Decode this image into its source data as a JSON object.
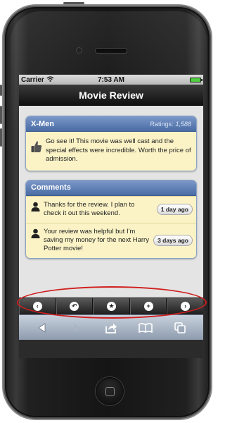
{
  "status_bar": {
    "carrier": "Carrier",
    "time": "7:53 AM",
    "wifi_icon": "wifi-icon",
    "battery_icon": "battery-icon"
  },
  "nav": {
    "title": "Movie Review"
  },
  "review": {
    "title": "X-Men",
    "rating_label": "Ratings:",
    "rating_count": "1,588",
    "icon": "thumbs-up-icon",
    "text": "Go see it! This movie was well cast and the special effects were incredible. Worth the price of admission."
  },
  "comments": {
    "title": "Comments",
    "items": [
      {
        "text": "Thanks for the review. I plan to check it out this weekend.",
        "time": "1 day ago",
        "icon": "person-icon"
      },
      {
        "text": "Your review was helpful but I'm saving my money for the next Harry Potter movie!",
        "time": "3 days ago",
        "icon": "person-icon"
      }
    ]
  },
  "toolbar": {
    "buttons": [
      {
        "icon": "chevron-left-icon",
        "glyph": "‹"
      },
      {
        "icon": "undo-icon",
        "glyph": "↶"
      },
      {
        "icon": "star-icon",
        "glyph": "★"
      },
      {
        "icon": "plus-icon",
        "glyph": "+"
      },
      {
        "icon": "chevron-right-icon",
        "glyph": "›"
      }
    ]
  },
  "safari_bar": {
    "buttons": [
      "back-arrow-icon",
      "forward-arrow-icon",
      "share-icon",
      "bookmarks-icon",
      "tabs-icon"
    ]
  },
  "colors": {
    "card_header": "#5a7bb3",
    "card_body": "#fbf3c6",
    "highlight": "#d11f1f"
  }
}
